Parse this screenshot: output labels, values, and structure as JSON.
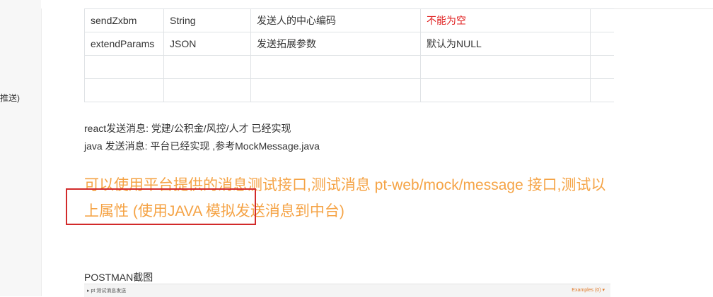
{
  "sidebar": {
    "fragment": "推送)"
  },
  "table": {
    "rows": [
      [
        "sendZxbm",
        "String",
        "发送人的中心编码",
        "不能为空",
        ""
      ],
      [
        "extendParams",
        "JSON",
        "发送拓展参数",
        "默认为NULL",
        ""
      ],
      [
        "",
        "",
        "",
        "",
        ""
      ],
      [
        "",
        "",
        "",
        "",
        ""
      ]
    ]
  },
  "content": {
    "line1": "react发送消息: 党建/公积金/风控/人才 已经实现",
    "line2": "java 发送消息: 平台已经实现 ,参考MockMessage.java",
    "highlight": "可以使用平台提供的消息测试接口,测试消息 pt-web/mock/message 接口,测试以上属性 (使用JAVA 模拟发送消息到中台)",
    "postman_label": "POSTMAN截图"
  },
  "postman": {
    "title": "▸ pt 测试消息发送",
    "examples": "Examples (0) ▾"
  },
  "colors": {
    "highlight": "#f5a345",
    "required": "#e02020",
    "box": "#d22a2a"
  }
}
